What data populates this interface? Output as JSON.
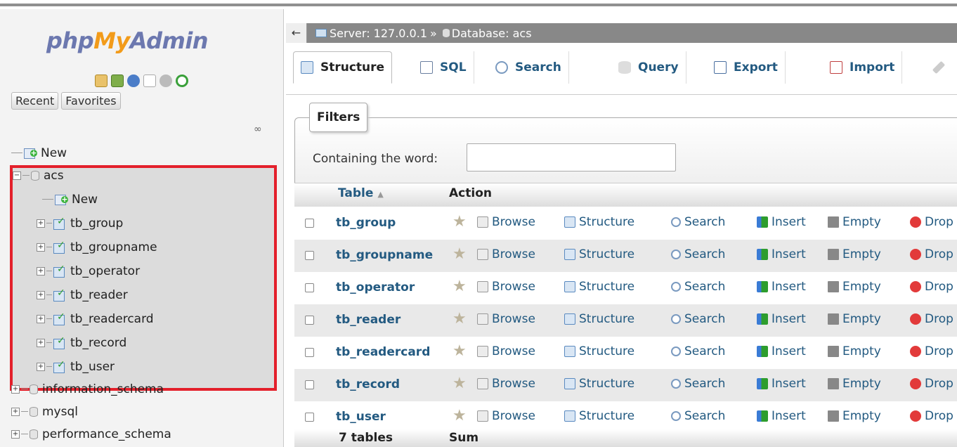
{
  "logo": {
    "part1": "php",
    "part2": "My",
    "part3": "Admin"
  },
  "nav_buttons": {
    "recent": "Recent",
    "favorites": "Favorites"
  },
  "tree": {
    "new_root": "New",
    "db_acs": "acs",
    "new_table": "New",
    "tables": [
      "tb_group",
      "tb_groupname",
      "tb_operator",
      "tb_reader",
      "tb_readercard",
      "tb_record",
      "tb_user"
    ],
    "other_dbs": [
      "information_schema",
      "mysql",
      "performance_schema"
    ]
  },
  "breadcrumb": {
    "back": "←",
    "server": "Server: 127.0.0.1",
    "sep": "»",
    "database": "Database: acs"
  },
  "tabs": [
    "Structure",
    "SQL",
    "Search",
    "Query",
    "Export",
    "Import"
  ],
  "filters": {
    "legend": "Filters",
    "label": "Containing the word:",
    "value": ""
  },
  "table_header": {
    "table": "Table",
    "sort_icon": "▲",
    "action": "Action"
  },
  "actions": {
    "browse": "Browse",
    "structure": "Structure",
    "search": "Search",
    "insert": "Insert",
    "empty": "Empty",
    "drop": "Drop"
  },
  "rows": [
    "tb_group",
    "tb_groupname",
    "tb_operator",
    "tb_reader",
    "tb_readercard",
    "tb_record",
    "tb_user"
  ],
  "footer": {
    "count": "7 tables",
    "sum": "Sum"
  },
  "colors": {
    "link": "#235a81",
    "highlight_border": "#e3202b",
    "breadcrumb_bg": "#888888"
  }
}
